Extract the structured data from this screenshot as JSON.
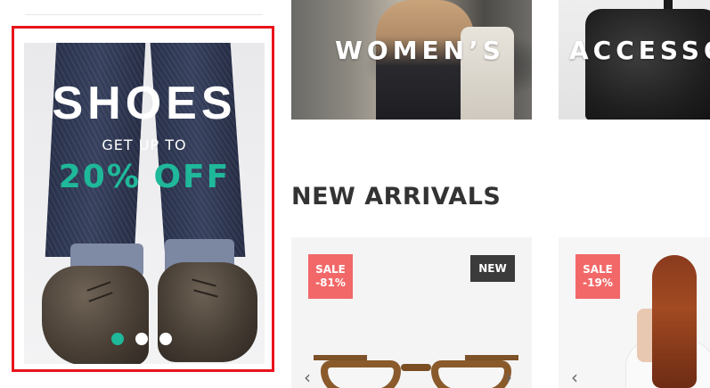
{
  "promo": {
    "title": "SHOES",
    "subtitle": "GET UP TO",
    "discount": "20% OFF",
    "slide_count": 3,
    "active_slide": 1
  },
  "categories": [
    {
      "label": "WOMEN’S"
    },
    {
      "label": "ACCESSO"
    }
  ],
  "section": {
    "title": "NEW ARRIVALS"
  },
  "products": [
    {
      "sale_label": "SALE",
      "sale_value": "-81%",
      "new_label": "NEW"
    },
    {
      "sale_label": "SALE",
      "sale_value": "-19%"
    }
  ],
  "colors": {
    "accent": "#1fb89a",
    "sale_badge": "#f26868",
    "new_badge": "#3b3b3b",
    "highlight_border": "#e8141b",
    "heading": "#333333"
  },
  "icons": [
    "chevron-left-icon",
    "chevron-right-icon"
  ]
}
